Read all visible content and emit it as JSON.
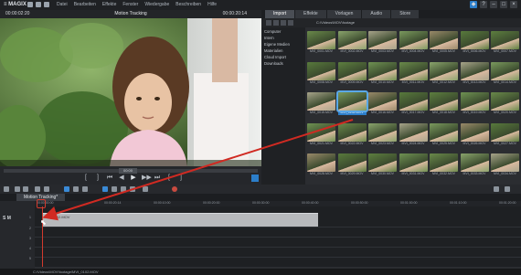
{
  "app": {
    "logo": "≡ MAGIX",
    "menus": [
      "Datei",
      "Bearbeiten",
      "Effekte",
      "Fenster",
      "Wiedergabe",
      "Beschreiben",
      "Hilfe"
    ]
  },
  "preview": {
    "timecode_left": "00:00:02:20",
    "title": "Motion Tracking",
    "timecode_right": "00:00:20:14",
    "scrub_label": "00:00"
  },
  "media_pool": {
    "tabs": [
      "Import",
      "Effekte",
      "Vorlagen",
      "Audio",
      "Store"
    ],
    "active_tab": "Import",
    "path": "C:\\Videos\\MOV\\footage",
    "tree": [
      "Computer",
      "Intern",
      "Eigene Medien",
      "Materialien",
      "Cloud Import",
      "Downloads"
    ],
    "thumbnails": [
      [
        "MVI_0001.MOV",
        "MVI_0002.MOV",
        "MVI_0003.MOV",
        "MVI_0004.MOV",
        "MVI_0005.MOV",
        "MVI_0006.MOV",
        "MVI_0007.MOV"
      ],
      [
        "MVI_0008.MOV",
        "MVI_0009.MOV",
        "MVI_0010.MOV",
        "MVI_0011.MOV",
        "MVI_0012.MOV",
        "MVI_0013.MOV",
        "MVI_0014.MOV"
      ],
      [
        "MVI_0015.MOV",
        "MVI_0102.MOV",
        "MVI_0016.MOV",
        "MVI_0017.MOV",
        "MVI_0018.MOV",
        "MVI_0019.MOV",
        "MVI_0020.MOV"
      ],
      [
        "MVI_0021.MOV",
        "MVI_0022.MOV",
        "MVI_0023.MOV",
        "MVI_0024.MOV",
        "MVI_0025.MOV",
        "MVI_0026.MOV",
        "MVI_0027.MOV"
      ],
      [
        "MVI_0028.MOV",
        "MVI_0029.MOV",
        "MVI_0030.MOV",
        "MVI_0031.MOV",
        "MVI_0032.MOV",
        "MVI_0033.MOV",
        "MVI_0034.MOV"
      ]
    ],
    "selected": "MVI_0102.MOV"
  },
  "timeline": {
    "project_tab": "Motion Tracking*",
    "ruler_marks": [
      "00:00:00:00",
      "00:00:20:14",
      "00:00:10:00",
      "00:00:20:00",
      "00:00:30:00",
      "00:00:40:00",
      "00:00:50:00",
      "00:01:00:00",
      "00:01:10:00",
      "00:01:20:00"
    ],
    "track_controls": "S M",
    "track_number": "1",
    "clip_label": "MVI_0102.MOV"
  },
  "status": {
    "path": "C:\\Videos\\MOV\\footage\\MVI_0102.MOV"
  },
  "colors": {
    "accent": "#2c7ec9",
    "playhead": "#d23a2e"
  }
}
